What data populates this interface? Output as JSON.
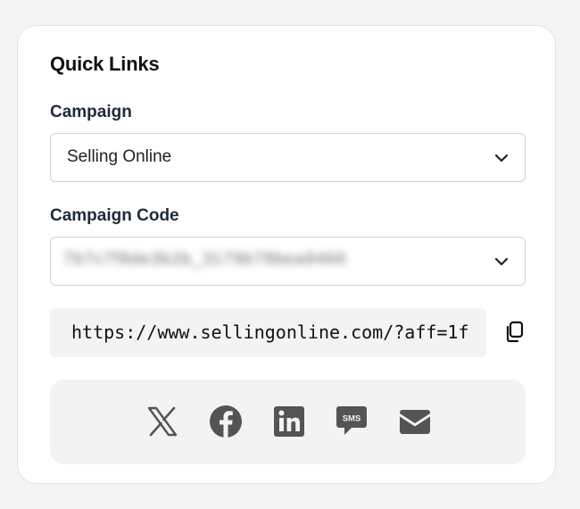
{
  "quick_links": {
    "title": "Quick Links",
    "campaign": {
      "label": "Campaign",
      "selected": "Selling Online"
    },
    "campaign_code": {
      "label": "Campaign Code",
      "selected": "7b7c7f9de3b2b_3179b78bea9466"
    },
    "link": {
      "url": "https://www.sellingonline.com/?aff=1f"
    },
    "share": {
      "items": [
        {
          "icon": "x-twitter-icon"
        },
        {
          "icon": "facebook-icon"
        },
        {
          "icon": "linkedin-icon"
        },
        {
          "icon": "sms-icon",
          "text": "SMS"
        },
        {
          "icon": "email-icon"
        }
      ]
    }
  },
  "colors": {
    "icon": "#545454",
    "card_bg": "#ffffff",
    "page_bg": "#f4f4f4",
    "field_bg": "#f3f3f3"
  }
}
